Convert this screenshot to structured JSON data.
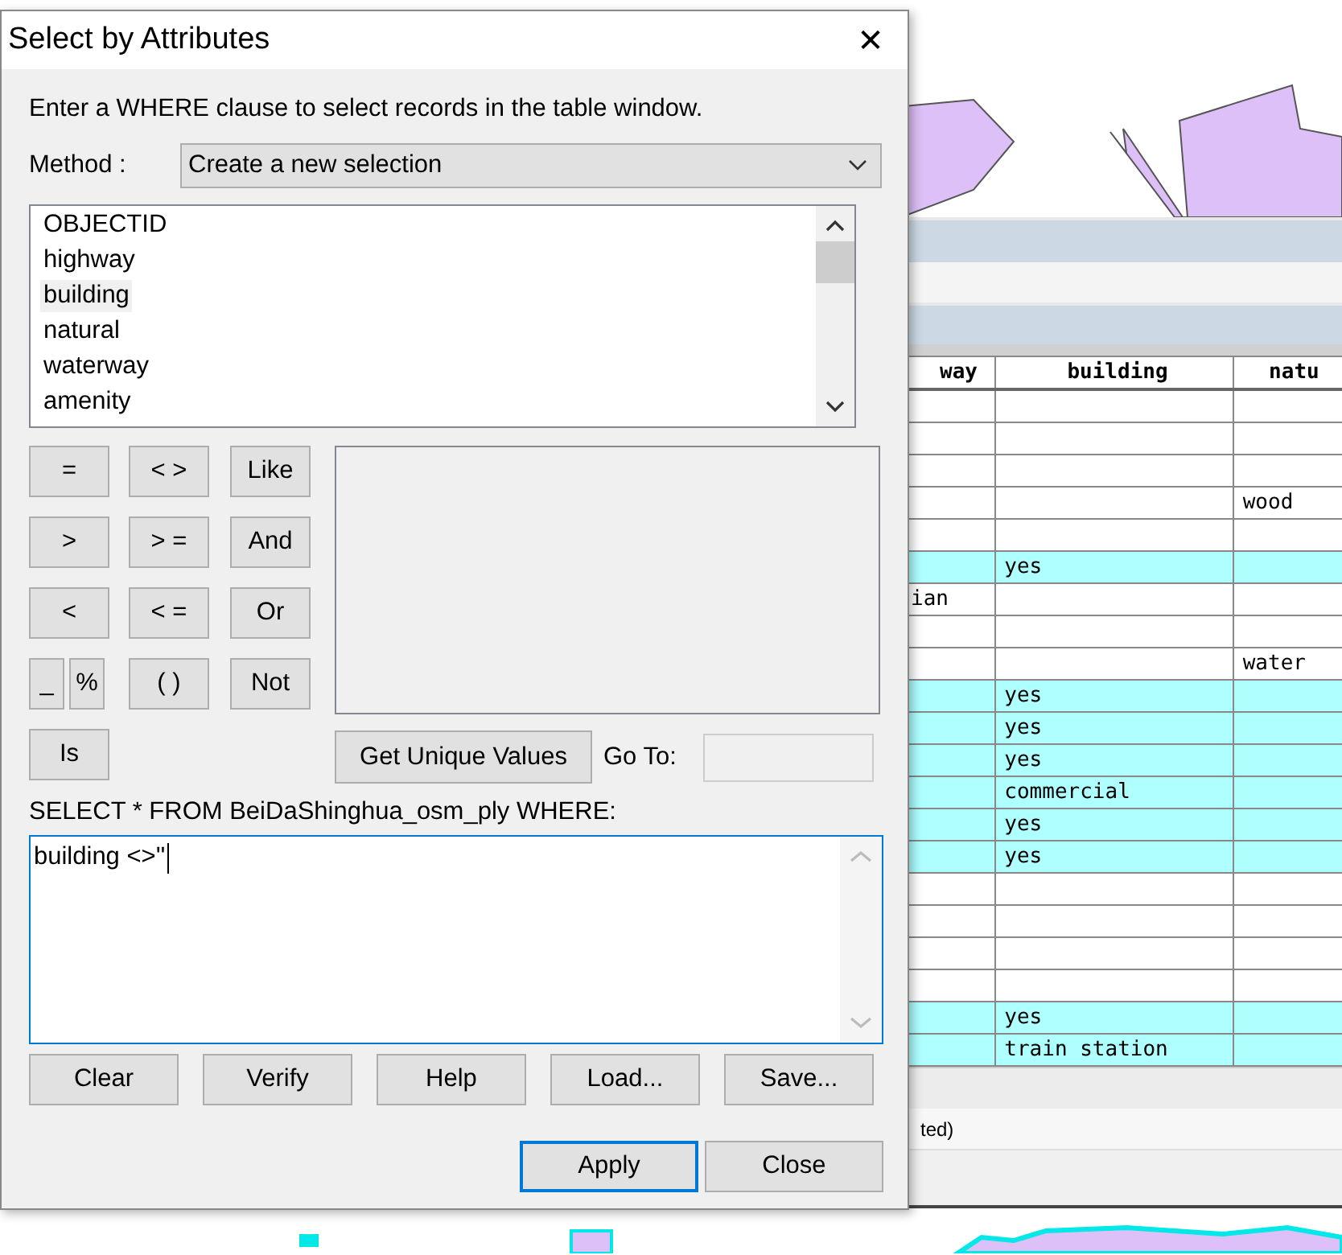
{
  "background_table": {
    "columns": [
      "way",
      "building",
      "natu"
    ],
    "rows": [
      {
        "selected": false,
        "cells": [
          "",
          "",
          ""
        ]
      },
      {
        "selected": false,
        "cells": [
          "",
          "",
          ""
        ]
      },
      {
        "selected": false,
        "cells": [
          "",
          "",
          ""
        ]
      },
      {
        "selected": false,
        "cells": [
          "",
          "",
          "wood"
        ]
      },
      {
        "selected": false,
        "cells": [
          "",
          "",
          ""
        ]
      },
      {
        "selected": true,
        "cells": [
          "",
          "yes",
          ""
        ]
      },
      {
        "selected": false,
        "cells": [
          "ian",
          "",
          ""
        ]
      },
      {
        "selected": false,
        "cells": [
          "",
          "",
          ""
        ]
      },
      {
        "selected": false,
        "cells": [
          "",
          "",
          "water"
        ]
      },
      {
        "selected": true,
        "cells": [
          "",
          "yes",
          ""
        ]
      },
      {
        "selected": true,
        "cells": [
          "",
          "yes",
          ""
        ]
      },
      {
        "selected": true,
        "cells": [
          "",
          "yes",
          ""
        ]
      },
      {
        "selected": true,
        "cells": [
          "",
          "commercial",
          ""
        ]
      },
      {
        "selected": true,
        "cells": [
          "",
          "yes",
          ""
        ]
      },
      {
        "selected": true,
        "cells": [
          "",
          "yes",
          ""
        ]
      },
      {
        "selected": false,
        "cells": [
          "",
          "",
          ""
        ]
      },
      {
        "selected": false,
        "cells": [
          "",
          "",
          ""
        ]
      },
      {
        "selected": false,
        "cells": [
          "",
          "",
          ""
        ]
      },
      {
        "selected": false,
        "cells": [
          "",
          "",
          ""
        ]
      },
      {
        "selected": true,
        "cells": [
          "",
          "yes",
          ""
        ]
      },
      {
        "selected": true,
        "cells": [
          "",
          "train station",
          ""
        ]
      }
    ],
    "status_text": "ted)"
  },
  "dialog": {
    "title": "Select by Attributes",
    "close": "✕",
    "instruction": "Enter a WHERE clause to select records in the table window.",
    "method_label": "Method :",
    "method_value": "Create a new selection",
    "fields": [
      {
        "name": "OBJECTID",
        "selected": false
      },
      {
        "name": "highway",
        "selected": false
      },
      {
        "name": "building",
        "selected": true
      },
      {
        "name": "natural",
        "selected": false
      },
      {
        "name": "waterway",
        "selected": false
      },
      {
        "name": "amenity",
        "selected": false
      }
    ],
    "operator_rows": [
      [
        [
          "="
        ],
        [
          "< >"
        ],
        [
          "Like"
        ]
      ],
      [
        [
          ">"
        ],
        [
          "> ="
        ],
        [
          "And"
        ]
      ],
      [
        [
          "<"
        ],
        [
          "< ="
        ],
        [
          "Or"
        ]
      ],
      [
        [
          "_",
          "%"
        ],
        [
          "( )"
        ],
        [
          "Not"
        ]
      ],
      [
        [
          "Is"
        ]
      ]
    ],
    "unique_button": "Get Unique Values",
    "goto_label": "Go To:",
    "sql_label": "SELECT * FROM BeiDaShinghua_osm_ply WHERE:",
    "expression": "building <>''",
    "tool_buttons": [
      "Clear",
      "Verify",
      "Help",
      "Load...",
      "Save..."
    ],
    "buttons": [
      {
        "label": "Apply",
        "default": true
      },
      {
        "label": "Close",
        "default": false
      }
    ]
  }
}
